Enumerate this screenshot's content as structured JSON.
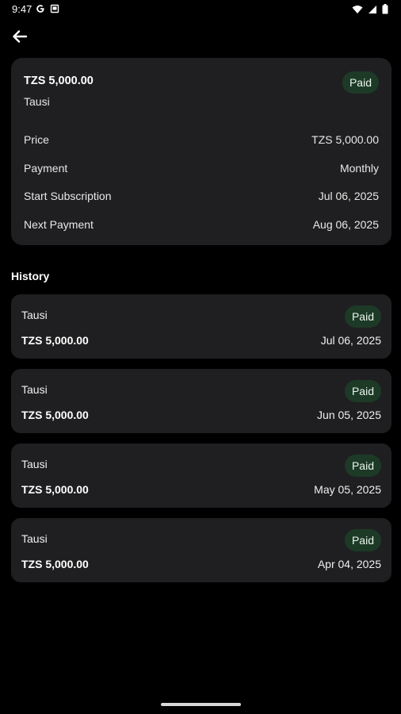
{
  "status_bar": {
    "time": "9:47",
    "left_icons": [
      "google-g-icon",
      "screenshot-icon"
    ],
    "right_icons": [
      "wifi-icon",
      "signal-icon",
      "battery-icon"
    ]
  },
  "app_bar": {
    "back_icon": "arrow-left-icon"
  },
  "summary": {
    "amount": "TZS 5,000.00",
    "name": "Tausi",
    "status": "Paid",
    "details": [
      {
        "label": "Price",
        "value": "TZS 5,000.00"
      },
      {
        "label": "Payment",
        "value": "Monthly"
      },
      {
        "label": "Start Subscription",
        "value": "Jul 06, 2025"
      },
      {
        "label": "Next Payment",
        "value": "Aug 06, 2025"
      }
    ]
  },
  "history": {
    "title": "History",
    "items": [
      {
        "name": "Tausi",
        "amount": "TZS 5,000.00",
        "date": "Jul 06, 2025",
        "status": "Paid"
      },
      {
        "name": "Tausi",
        "amount": "TZS 5,000.00",
        "date": "Jun 05, 2025",
        "status": "Paid"
      },
      {
        "name": "Tausi",
        "amount": "TZS 5,000.00",
        "date": "May 05, 2025",
        "status": "Paid"
      },
      {
        "name": "Tausi",
        "amount": "TZS 5,000.00",
        "date": "Apr 04, 2025",
        "status": "Paid"
      }
    ]
  },
  "colors": {
    "background": "#000000",
    "card": "#1f1f21",
    "paid_badge_bg": "#1d3a27",
    "text": "#ffffff"
  }
}
